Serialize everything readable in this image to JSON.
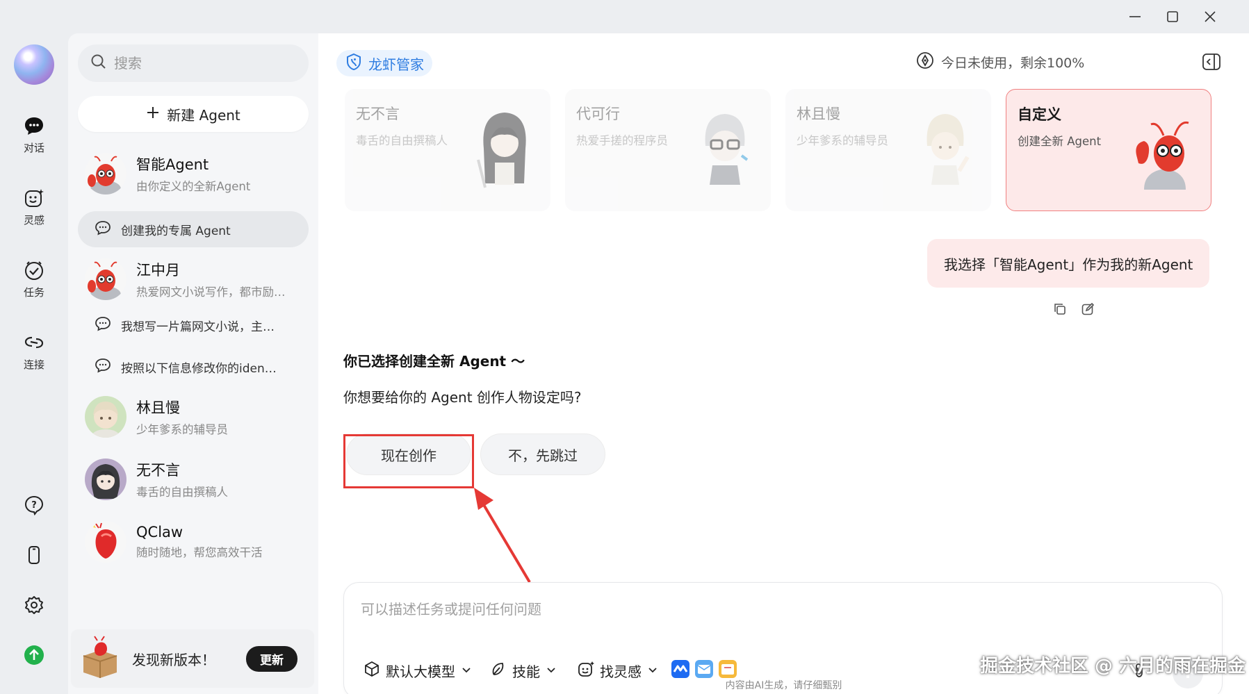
{
  "window": {
    "controls": [
      "minimize",
      "maximize",
      "close"
    ]
  },
  "rail": {
    "items": [
      {
        "label": "对话",
        "icon": "chat-bubble-icon"
      },
      {
        "label": "灵感",
        "icon": "smiley-sparkle-icon"
      },
      {
        "label": "任务",
        "icon": "check-circle-icon"
      },
      {
        "label": "连接",
        "icon": "link-icon"
      }
    ],
    "bottom": [
      "help-icon",
      "phone-icon",
      "settings-icon",
      "upgrade-icon"
    ]
  },
  "sidebar": {
    "search_placeholder": "搜索",
    "new_agent": "新建 Agent",
    "agents": [
      {
        "name": "智能Agent",
        "desc": "由你定义的全新Agent"
      },
      {
        "name": "江中月",
        "desc": "热爱网文小说写作，都市励…"
      },
      {
        "name": "林且慢",
        "desc": "少年爹系的辅导员"
      },
      {
        "name": "无不言",
        "desc": "毒舌的自由撰稿人"
      },
      {
        "name": "QClaw",
        "desc": "随时随地，帮您高效干活"
      }
    ],
    "conversations": [
      {
        "text": "创建我的专属 Agent"
      },
      {
        "text": "我想写一片篇网文小说，主…"
      },
      {
        "text": "按照以下信息修改你的iden…"
      }
    ],
    "update": {
      "message": "发现新版本！",
      "button": "更新"
    }
  },
  "main": {
    "brand": "龙虾管家",
    "usage": "今日未使用，剩余100%",
    "cards": [
      {
        "title": "无不言",
        "desc": "毒舌的自由撰稿人"
      },
      {
        "title": "代可行",
        "desc": "热爱手搓的程序员"
      },
      {
        "title": "林且慢",
        "desc": "少年爹系的辅导员"
      },
      {
        "title": "自定义",
        "desc": "创建全新 Agent"
      }
    ],
    "user_message": "我选择「智能Agent」作为我的新Agent",
    "reply_title": "你已选择创建全新 Agent 〜",
    "reply_question": "你想要给你的 Agent 创作人物设定吗?",
    "options": [
      "现在创作",
      "不，先跳过"
    ],
    "composer": {
      "placeholder": "可以描述任务或提问任何问题",
      "model": "默认大模型",
      "skills": "技能",
      "inspiration": "找灵感"
    },
    "disclaimer": "内容由AI生成，请仔细甄别",
    "watermark": "掘金技术社区 @ 六月的雨在掘金"
  },
  "colors": {
    "accent_blue": "#2f7de1",
    "highlight_red": "#e53935",
    "update_green": "#22b14c"
  }
}
